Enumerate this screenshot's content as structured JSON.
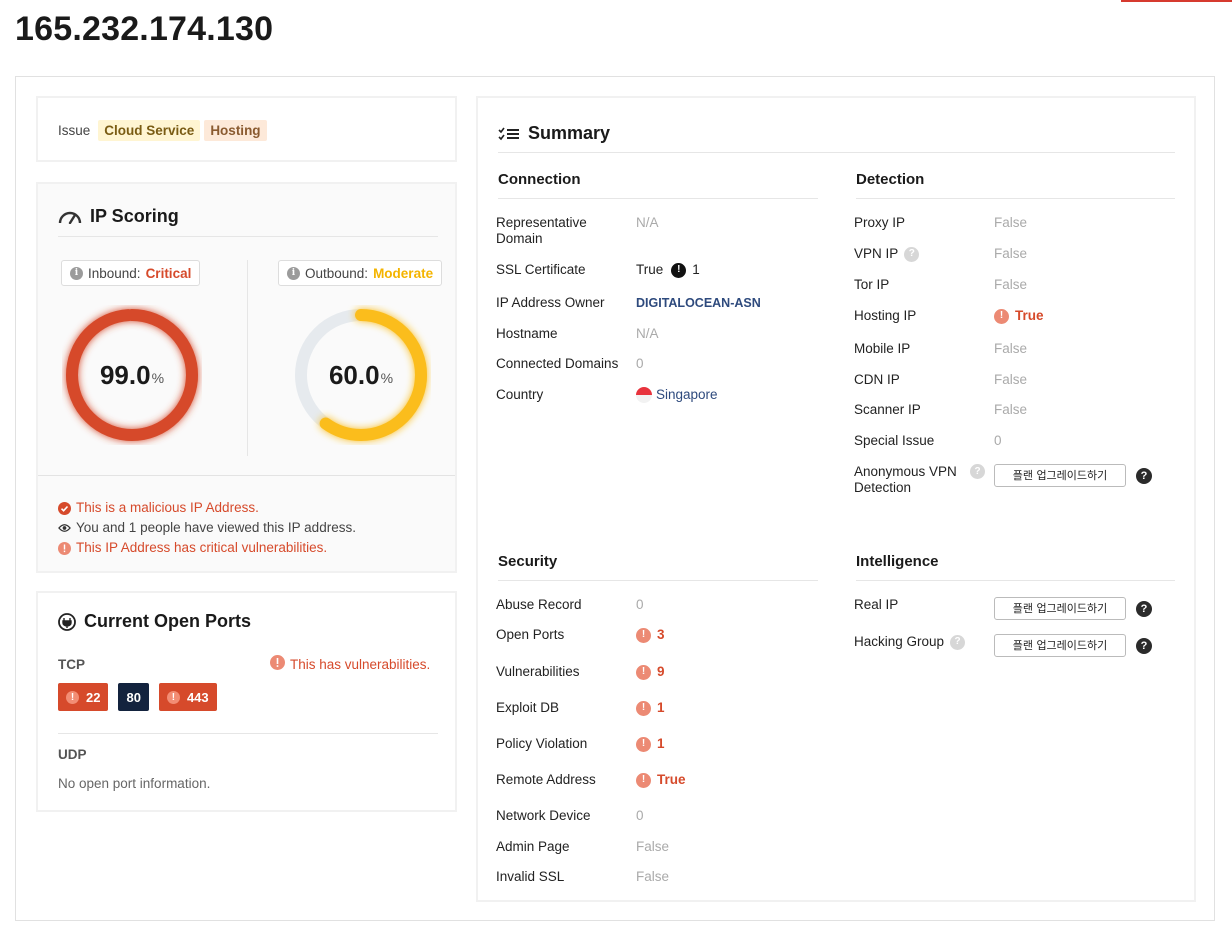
{
  "page": {
    "title": "165.232.174.130"
  },
  "issue": {
    "label": "Issue",
    "tags": [
      "Cloud Service",
      "Hosting"
    ]
  },
  "scoring": {
    "title": "IP Scoring",
    "inbound": {
      "label": "Inbound:",
      "level": "Critical",
      "value": "99.0",
      "unit": "%",
      "fraction": 0.99,
      "color": "#d64a2b"
    },
    "outbound": {
      "label": "Outbound:",
      "level": "Moderate",
      "value": "60.0",
      "unit": "%",
      "fraction": 0.6,
      "color": "#fbbd1e"
    },
    "notes": [
      "This is a malicious IP Address.",
      "You and 1 people have viewed this IP address.",
      "This IP Address has critical vulnerabilities."
    ]
  },
  "ports": {
    "title": "Current Open Ports",
    "tcp_label": "TCP",
    "vuln_warning": "This has vulnerabilities.",
    "tcp": [
      "22",
      "80",
      "443"
    ],
    "udp_label": "UDP",
    "udp_empty": "No open port information."
  },
  "summary": {
    "title": "Summary",
    "upgrade_label": "플랜 업그레이드하기",
    "connection": {
      "title": "Connection",
      "representative_domain": {
        "label": "Representative Domain",
        "value": "N/A"
      },
      "ssl_certificate": {
        "label": "SSL Certificate",
        "value": "True",
        "count": "1"
      },
      "owner": {
        "label": "IP Address Owner",
        "value": "DIGITALOCEAN-ASN"
      },
      "hostname": {
        "label": "Hostname",
        "value": "N/A"
      },
      "connected_domains": {
        "label": "Connected Domains",
        "value": "0"
      },
      "country": {
        "label": "Country",
        "value": "Singapore"
      }
    },
    "detection": {
      "title": "Detection",
      "proxy_ip": {
        "label": "Proxy IP",
        "value": "False"
      },
      "vpn_ip": {
        "label": "VPN IP",
        "value": "False"
      },
      "tor_ip": {
        "label": "Tor IP",
        "value": "False"
      },
      "hosting_ip": {
        "label": "Hosting IP",
        "value": "True"
      },
      "mobile_ip": {
        "label": "Mobile IP",
        "value": "False"
      },
      "cdn_ip": {
        "label": "CDN IP",
        "value": "False"
      },
      "scanner_ip": {
        "label": "Scanner IP",
        "value": "False"
      },
      "special_issue": {
        "label": "Special Issue",
        "value": "0"
      },
      "anonymous_vpn": {
        "label": "Anonymous VPN Detection"
      }
    },
    "security": {
      "title": "Security",
      "abuse_record": {
        "label": "Abuse Record",
        "value": "0"
      },
      "open_ports": {
        "label": "Open Ports",
        "value": "3"
      },
      "vulnerabilities": {
        "label": "Vulnerabilities",
        "value": "9"
      },
      "exploit_db": {
        "label": "Exploit DB",
        "value": "1"
      },
      "policy_violation": {
        "label": "Policy Violation",
        "value": "1"
      },
      "remote_address": {
        "label": "Remote Address",
        "value": "True"
      },
      "network_device": {
        "label": "Network Device",
        "value": "0"
      },
      "admin_page": {
        "label": "Admin Page",
        "value": "False"
      },
      "invalid_ssl": {
        "label": "Invalid SSL",
        "value": "False"
      }
    },
    "intelligence": {
      "title": "Intelligence",
      "real_ip": {
        "label": "Real IP"
      },
      "hacking_group": {
        "label": "Hacking Group"
      }
    }
  }
}
